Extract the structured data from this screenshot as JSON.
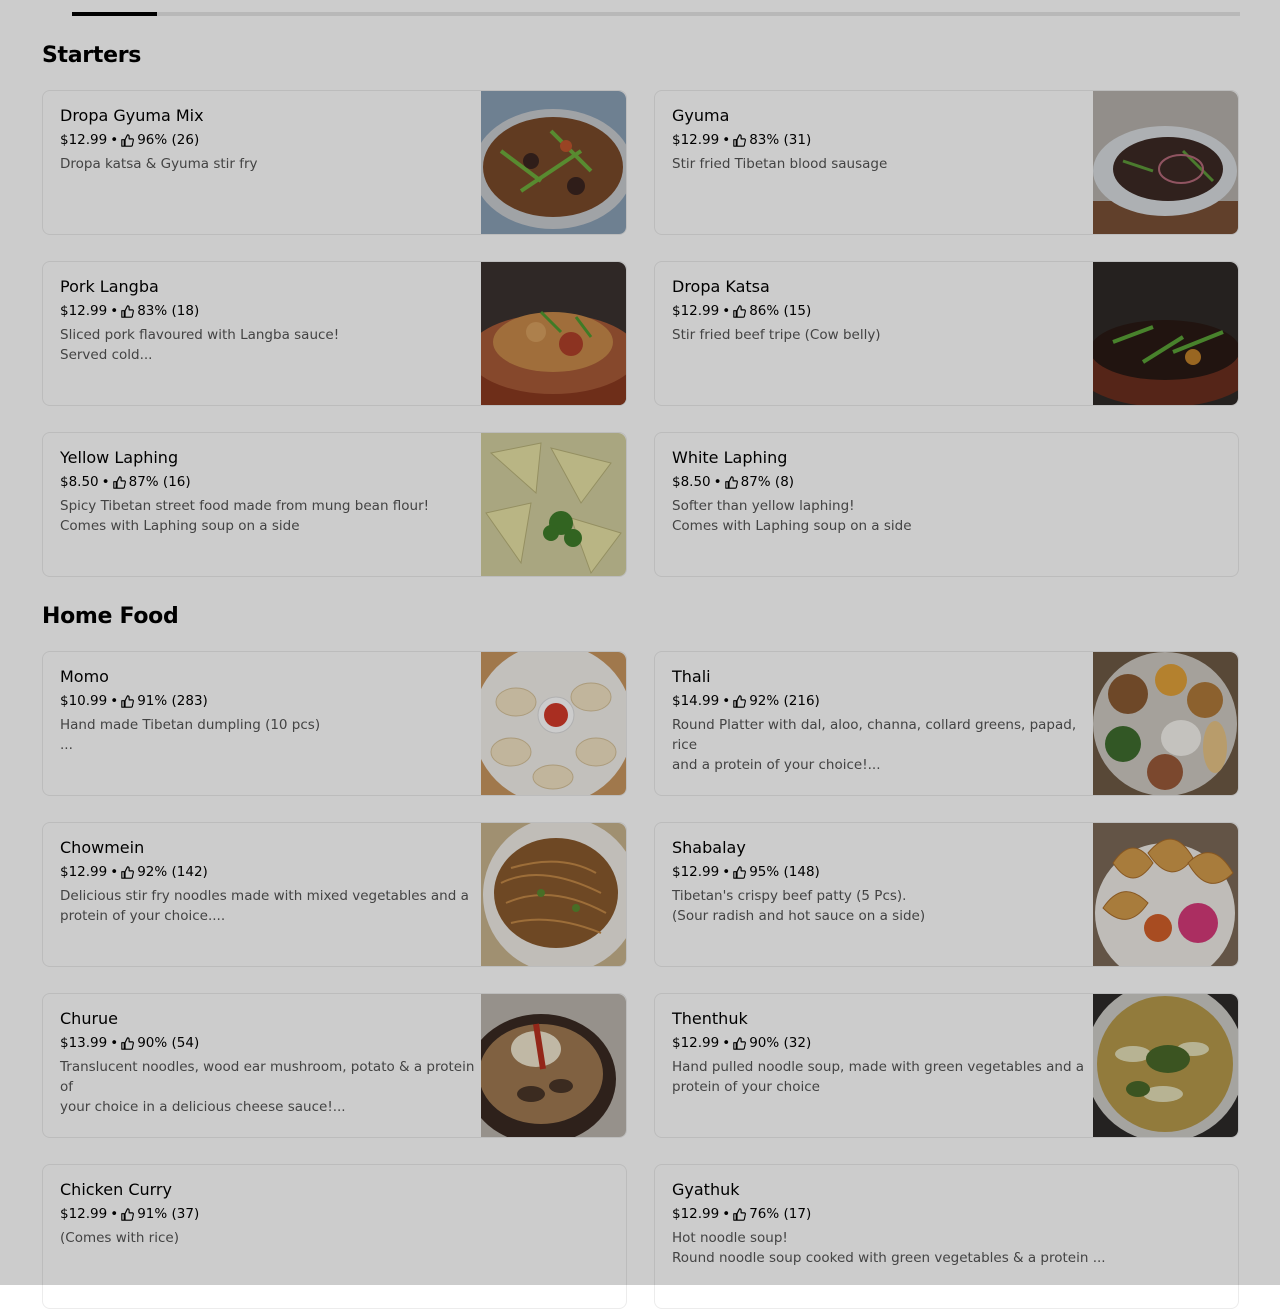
{
  "sections": [
    {
      "title": "Starters",
      "items": [
        {
          "name": "Dropa Gyuma Mix",
          "price": "$12.99",
          "rating": "96% (26)",
          "description": "Dropa katsa & Gyuma stir fry",
          "image": "dropa-gyuma-mix-photo"
        },
        {
          "name": "Gyuma",
          "price": "$12.99",
          "rating": "83% (31)",
          "description": "Stir fried Tibetan blood sausage",
          "image": "gyuma-photo"
        },
        {
          "name": "Pork Langba",
          "price": "$12.99",
          "rating": "83% (18)",
          "description": "Sliced pork flavoured with Langba sauce!\nServed cold...",
          "image": "pork-langba-photo"
        },
        {
          "name": "Dropa Katsa",
          "price": "$12.99",
          "rating": "86% (15)",
          "description": "Stir fried beef tripe (Cow belly)",
          "image": "dropa-katsa-photo"
        },
        {
          "name": "Yellow Laphing",
          "price": "$8.50",
          "rating": "87% (16)",
          "description": "Spicy Tibetan street food made from mung bean flour!\nComes with Laphing soup on a side",
          "image": "yellow-laphing-photo"
        },
        {
          "name": "White Laphing",
          "price": "$8.50",
          "rating": "87% (8)",
          "description": "Softer than yellow laphing!\nComes with Laphing soup on a side",
          "image": ""
        }
      ]
    },
    {
      "title": "Home Food",
      "items": [
        {
          "name": "Momo",
          "price": "$10.99",
          "rating": "91% (283)",
          "description": "Hand made Tibetan dumpling (10 pcs)\n...",
          "image": "momo-photo"
        },
        {
          "name": "Thali",
          "price": "$14.99",
          "rating": "92% (216)",
          "description": "Round Platter with dal, aloo, channa, collard greens, papad, rice\nand a protein of your choice!...",
          "image": "thali-photo"
        },
        {
          "name": "Chowmein",
          "price": "$12.99",
          "rating": "92% (142)",
          "description": "Delicious stir fry noodles made with mixed vegetables and a\nprotein of your choice....",
          "image": "chowmein-photo"
        },
        {
          "name": "Shabalay",
          "price": "$12.99",
          "rating": "95% (148)",
          "description": "Tibetan's crispy beef patty (5 Pcs).\n(Sour radish and hot sauce on a side)",
          "image": "shabalay-photo"
        },
        {
          "name": "Churue",
          "price": "$13.99",
          "rating": "90% (54)",
          "description": "Translucent noodles, wood ear mushroom, potato & a protein of\nyour choice in a delicious cheese sauce!...",
          "image": "churue-photo"
        },
        {
          "name": "Thenthuk",
          "price": "$12.99",
          "rating": "90% (32)",
          "description": "Hand pulled noodle soup, made with green vegetables and a\nprotein of your choice",
          "image": "thenthuk-photo"
        },
        {
          "name": "Chicken Curry",
          "price": "$12.99",
          "rating": "91% (37)",
          "description": "(Comes with rice)",
          "image": ""
        },
        {
          "name": "Gyathuk",
          "price": "$12.99",
          "rating": "76% (17)",
          "description": "Hot noodle soup!\nRound noodle soup cooked with green vegetables & a protein ...",
          "image": ""
        }
      ]
    }
  ],
  "icons": {
    "rating": "thumbs-up-icon"
  },
  "colors": {
    "overlay": "rgba(0,0,0,0.2)",
    "description_text": "#545454",
    "card_border": "#ececec",
    "tab_active": "#000000"
  }
}
